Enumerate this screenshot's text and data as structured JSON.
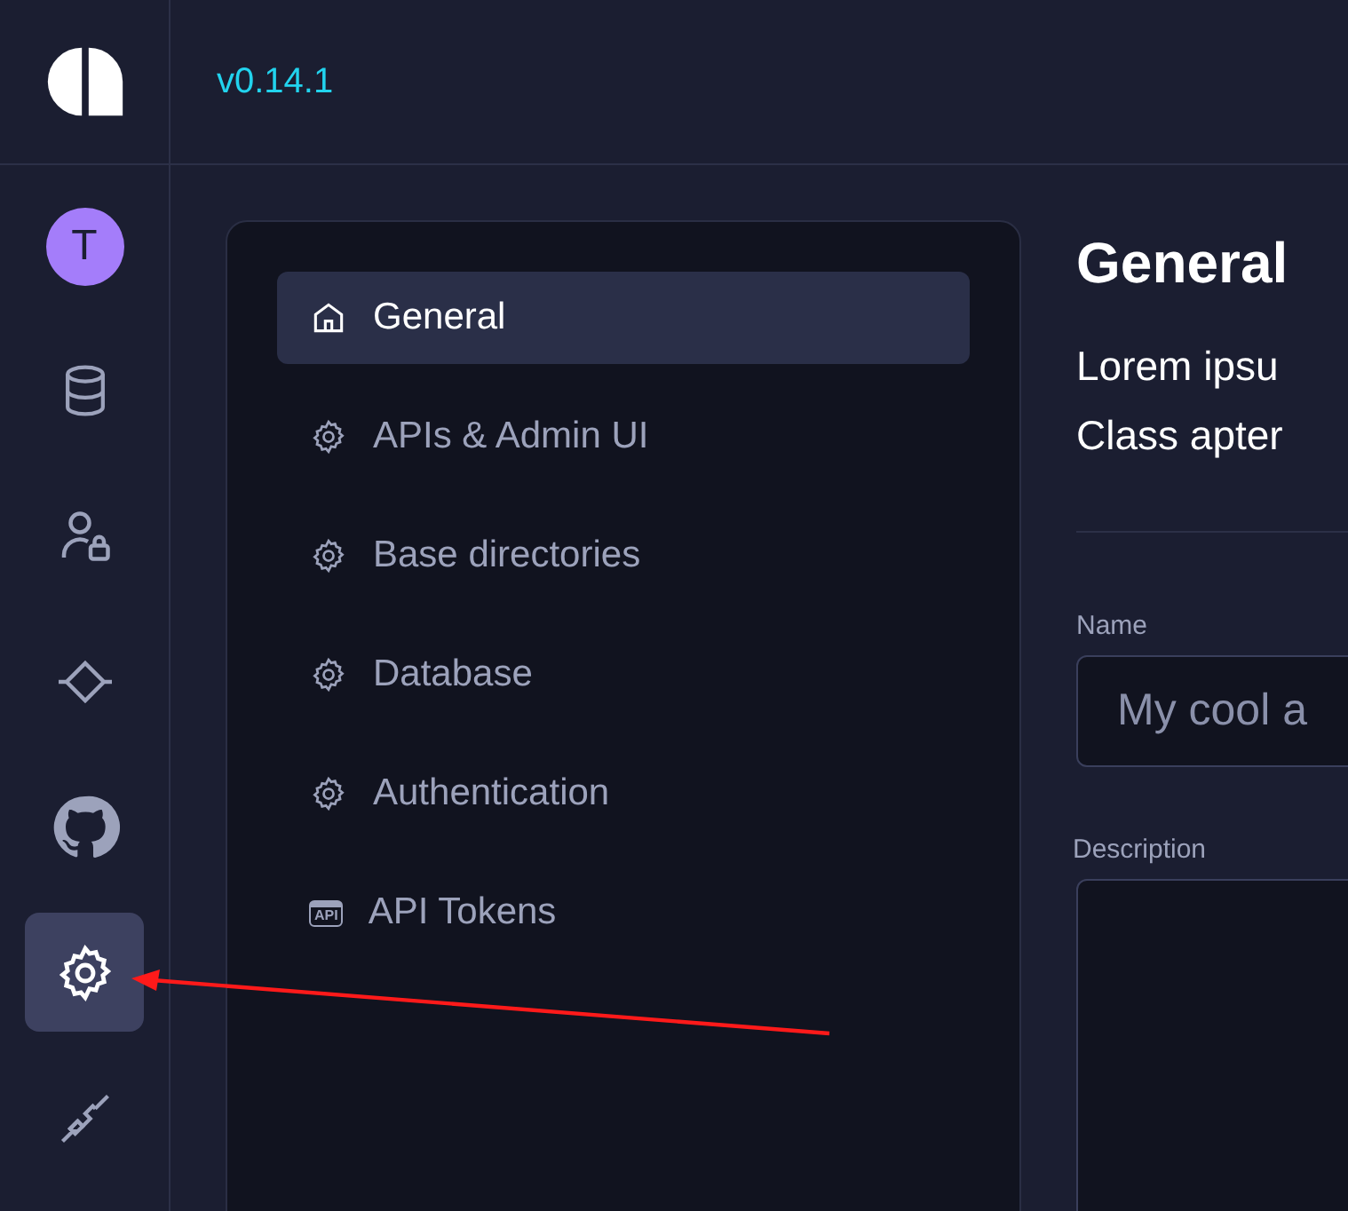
{
  "version": "v0.14.1",
  "rail": [
    {
      "kind": "avatar",
      "label": "T",
      "selected": false
    },
    {
      "kind": "database",
      "selected": false
    },
    {
      "kind": "user-lock",
      "selected": false
    },
    {
      "kind": "diamond",
      "selected": false
    },
    {
      "kind": "github",
      "selected": false
    },
    {
      "kind": "gear",
      "selected": true
    },
    {
      "kind": "plug",
      "selected": false
    }
  ],
  "menu": [
    {
      "label": "General",
      "kind": "home",
      "selected": true
    },
    {
      "label": "APIs & Admin UI",
      "kind": "gear",
      "selected": false
    },
    {
      "label": "Base directories",
      "kind": "gear",
      "selected": false
    },
    {
      "label": "Database",
      "kind": "gear",
      "selected": false
    },
    {
      "label": "Authentication",
      "kind": "gear",
      "selected": false
    },
    {
      "label": "API Tokens",
      "kind": "api",
      "icon_label": "API",
      "selected": false
    }
  ],
  "heading": "General",
  "intro": [
    "Lorem ipsu",
    "Class apter"
  ],
  "name_field": {
    "label": "Name",
    "placeholder": "My cool a"
  },
  "description_field": {
    "label": "Description"
  }
}
